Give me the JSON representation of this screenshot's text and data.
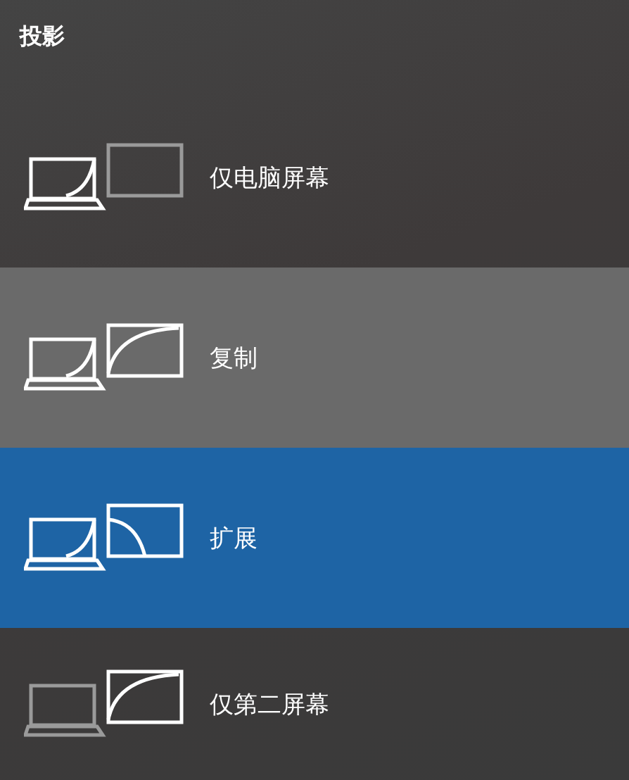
{
  "panel": {
    "title": "投影"
  },
  "options": [
    {
      "kind": "pc_only",
      "label": "仅电脑屏幕",
      "selected": false,
      "hovered": false
    },
    {
      "kind": "duplicate",
      "label": "复制",
      "selected": false,
      "hovered": true
    },
    {
      "kind": "extend",
      "label": "扩展",
      "selected": true,
      "hovered": false
    },
    {
      "kind": "second_only",
      "label": "仅第二屏幕",
      "selected": false,
      "hovered": false
    }
  ]
}
